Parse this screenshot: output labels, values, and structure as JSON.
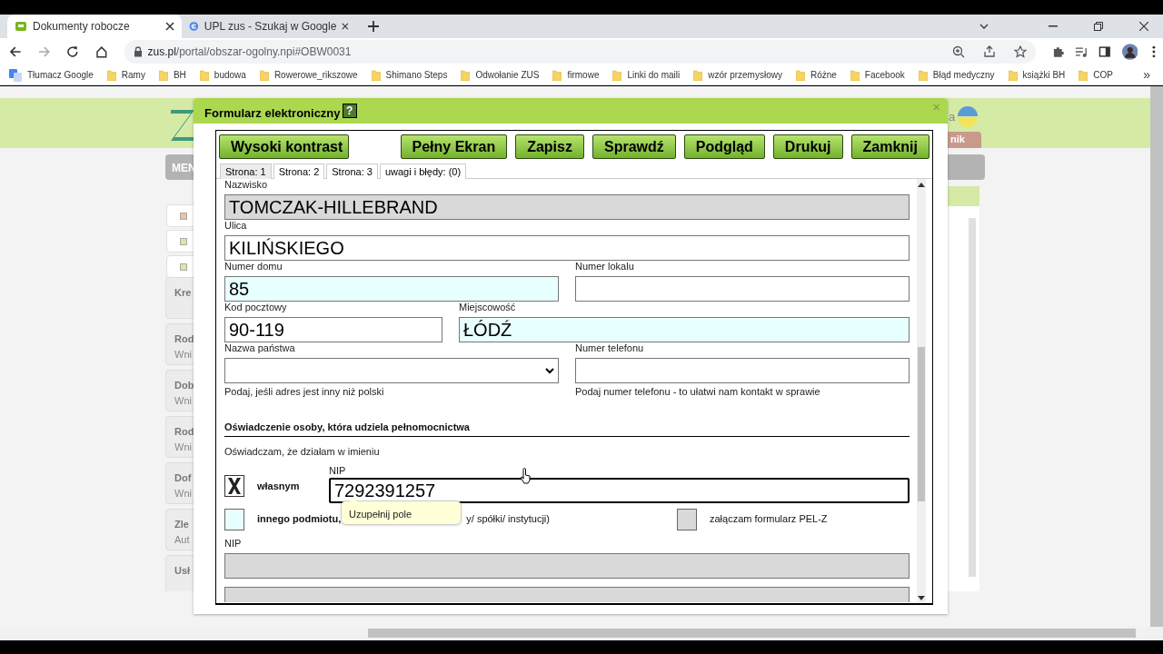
{
  "browser": {
    "tabs": [
      {
        "title": "Dokumenty robocze",
        "selected": true,
        "kind": "site"
      },
      {
        "title": "UPL zus - Szukaj w Google",
        "selected": false,
        "kind": "google"
      }
    ],
    "address": {
      "host": "zus.pl",
      "path": "/portal/obszar-ogolny.npi#OBW0031"
    },
    "bookmarks": [
      {
        "label": "Tłumacz Google",
        "kind": "translate"
      },
      {
        "label": "Ramy",
        "kind": "folder"
      },
      {
        "label": "BH",
        "kind": "folder"
      },
      {
        "label": "budowa",
        "kind": "folder"
      },
      {
        "label": "Rowerowe_rikszowe",
        "kind": "folder"
      },
      {
        "label": "Shimano Steps",
        "kind": "folder"
      },
      {
        "label": "Odwołanie ZUS",
        "kind": "folder"
      },
      {
        "label": "firmowe",
        "kind": "folder"
      },
      {
        "label": "Linki do maili",
        "kind": "folder"
      },
      {
        "label": "wzór przemysłowy",
        "kind": "folder"
      },
      {
        "label": "Różne",
        "kind": "folder"
      },
      {
        "label": "Facebook",
        "kind": "folder"
      },
      {
        "label": "Błąd medyczny",
        "kind": "folder"
      },
      {
        "label": "książki BH",
        "kind": "folder"
      },
      {
        "label": "COP",
        "kind": "folder"
      }
    ],
    "more_bookmarks": "»"
  },
  "background": {
    "menu_label": "MEN",
    "header_fragment": "a",
    "tab_fragment": "nik",
    "cards": [
      {
        "title": "Kre"
      },
      {
        "title": "Rod",
        "subtitle": "Wni"
      },
      {
        "title": "Dob",
        "subtitle": "Wni"
      },
      {
        "title": "Rod",
        "subtitle": "Wni"
      },
      {
        "title": "Dof",
        "subtitle": "Wni"
      },
      {
        "title": "Zle",
        "subtitle": "Aut"
      },
      {
        "title": "Usł"
      }
    ]
  },
  "dialog": {
    "title": "Formularz elektroniczny",
    "help": "?",
    "close": "×",
    "buttons": [
      {
        "label": "Wysoki kontrast"
      },
      {
        "label": "Pełny Ekran"
      },
      {
        "label": "Zapisz"
      },
      {
        "label": "Sprawdź"
      },
      {
        "label": "Podgląd"
      },
      {
        "label": "Drukuj"
      },
      {
        "label": "Zamknij"
      }
    ],
    "tabs": [
      {
        "label": "Strona: 1",
        "selected": true
      },
      {
        "label": "Strona: 2",
        "selected": false
      },
      {
        "label": "Strona: 3",
        "selected": false
      },
      {
        "label": "uwagi i błędy: (0)",
        "selected": false
      }
    ],
    "rows": [
      [
        {
          "label": "Nazwisko",
          "value": "TOMCZAK-HILLEBRAND",
          "kind": "text",
          "readonly": true
        }
      ],
      [
        {
          "label": "Ulica",
          "value": "KILIŃSKIEGO",
          "kind": "text",
          "readonly": false,
          "highlighted": false
        }
      ],
      [
        {
          "label": "Numer domu",
          "value": "85",
          "kind": "text",
          "readonly": false,
          "highlighted": true
        },
        {
          "label": "Numer lokalu",
          "kind": "text",
          "readonly": false,
          "highlighted": false
        }
      ],
      [
        {
          "label": "Kod pocztowy",
          "value": "90-119",
          "kind": "text",
          "readonly": false,
          "highlighted": false
        },
        {
          "label": "Miejscowość",
          "value": "ŁÓDŹ",
          "kind": "text",
          "readonly": false,
          "highlighted": true
        }
      ],
      [
        {
          "label": "Nazwa państwa",
          "kind": "select",
          "readonly": false,
          "highlighted": false,
          "hint": "Podaj, jeśli adres jest inny niż polski"
        },
        {
          "label": "Numer telefonu",
          "kind": "text",
          "readonly": false,
          "highlighted": false,
          "hint": "Podaj numer telefonu - to ułatwi nam kontakt w sprawie"
        }
      ]
    ],
    "declaration": {
      "heading": "Oświadczenie osoby, która udziela pełnomocnictwa",
      "intro": "Oświadczam, że działam w imieniu",
      "own": {
        "label": "własnym",
        "checked": true
      },
      "nip": {
        "label": "NIP",
        "value": "7292391257",
        "focused": true
      },
      "tooltip": "Uzupełnij pole",
      "other": {
        "label": "innego podmiotu,",
        "tail": "y/ spółki/ instytucji)",
        "checked": false
      },
      "attachment": {
        "label": "załączam formularz PEL-Z",
        "checked": false,
        "disabled": true
      },
      "other_nip": {
        "label": "NIP",
        "readonly": true
      },
      "next_field": {
        "readonly": true
      }
    }
  }
}
